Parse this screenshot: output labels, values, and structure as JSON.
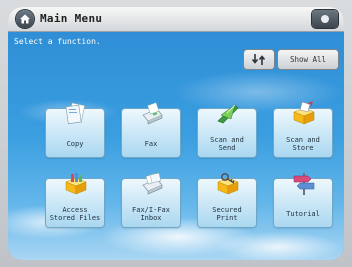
{
  "header": {
    "title": "Main Menu"
  },
  "main": {
    "instruction": "Select a function.",
    "show_all_label": "Show All",
    "tiles": [
      {
        "label": "Copy"
      },
      {
        "label": "Fax"
      },
      {
        "label": "Scan and\nSend"
      },
      {
        "label": "Scan and\nStore"
      },
      {
        "label": "Access\nStored Files"
      },
      {
        "label": "Fax/I-Fax\nInbox"
      },
      {
        "label": "Secured\nPrint"
      },
      {
        "label": "Tutorial"
      }
    ]
  },
  "colors": {
    "sky_top": "#2f8ed6",
    "tile_border": "#6fa7c9"
  },
  "icons": {
    "home": "home-icon",
    "status": "status-monitor-icon",
    "swap": "swap-arrows-icon"
  }
}
